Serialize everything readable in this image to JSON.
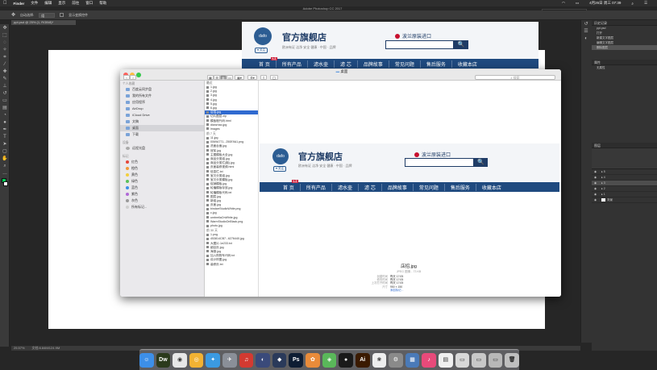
{
  "menubar": {
    "apple": "",
    "items": [
      "Finder",
      "文件",
      "编辑",
      "显示",
      "前往",
      "窗口",
      "帮助"
    ],
    "right_time": "4月26日 周三 07:39"
  },
  "ps_window_title": "Adobe Photoshop CC 2017",
  "tooltip": "预览此处就会变成切片",
  "options": {
    "mode_label": "自动选择:",
    "layer_select": "组",
    "transform_label": "显示变换控件"
  },
  "doc_tab": "ppt.psd @ 25% (1, RGB/8)*",
  "ps_status": {
    "zoom": "25.57%",
    "doc": "文档:6.84M/124.9M"
  },
  "history_panel": {
    "title": "历史记录",
    "items": [
      {
        "label": "ppt.psd",
        "selected": false
      },
      {
        "label": "打开",
        "selected": false
      },
      {
        "label": "新建文字图层",
        "selected": false
      },
      {
        "label": "编辑文字图层",
        "selected": false
      },
      {
        "label": "删除图层",
        "selected": true
      }
    ]
  },
  "props_panel": {
    "title": "属性",
    "sub": "无属性"
  },
  "layers_panel": {
    "title": "图层",
    "rows": [
      {
        "label": "5",
        "selected": false
      },
      {
        "label": "4",
        "selected": false
      },
      {
        "label": "3",
        "selected": true
      },
      {
        "label": "2",
        "selected": false
      },
      {
        "label": "1",
        "selected": false
      },
      {
        "label": "背景",
        "selected": false
      }
    ]
  },
  "web_header": {
    "logo_text": "dafo",
    "shop_name": "官方旗舰店",
    "shop_sub": "欧洲有证 洁净 安全 健康 · 中国 · 品牌",
    "follow": "♥ 关注",
    "origin": "波兰原装进口",
    "search_btn": "🔍",
    "badge": "热卖",
    "nav": [
      "首 页",
      "所有产品",
      "滤水壶",
      "滤 芯",
      "品牌故事",
      "常见问题",
      "售后服务",
      "收藏本店"
    ]
  },
  "finder": {
    "title": "桌面",
    "search_placeholder": "搜索",
    "sidebar": {
      "personal_header": "个人收藏",
      "personal": [
        {
          "label": "百度云同步盘",
          "selected": false
        },
        {
          "label": "我的所有文件",
          "selected": false
        },
        {
          "label": "应用程序",
          "selected": false
        },
        {
          "label": "AirDrop",
          "selected": false
        },
        {
          "label": "iCloud Drive",
          "selected": false
        },
        {
          "label": "文稿",
          "selected": false
        },
        {
          "label": "桌面",
          "selected": true
        },
        {
          "label": "下载",
          "selected": false
        }
      ],
      "devices_header": "设备",
      "devices": [
        "远程光盘"
      ],
      "tags_header": "标记",
      "tags": [
        {
          "label": "红色",
          "color": "#e5453a"
        },
        {
          "label": "橙色",
          "color": "#f19a38"
        },
        {
          "label": "黄色",
          "color": "#f3cf3d"
        },
        {
          "label": "绿色",
          "color": "#5ac05a"
        },
        {
          "label": "蓝色",
          "color": "#3d8fe8"
        },
        {
          "label": "紫色",
          "color": "#b16ad6"
        },
        {
          "label": "灰色",
          "color": "#9a9a9a"
        },
        {
          "label": "所有标记...",
          "color": "#cfcfcf"
        }
      ]
    },
    "list": {
      "header_recent": "最近",
      "recent": [
        {
          "label": "1.jpg",
          "selected": false
        },
        {
          "label": "2.jpg",
          "selected": false
        },
        {
          "label": "3.jpg",
          "selected": false
        },
        {
          "label": "4.jpg",
          "selected": false
        },
        {
          "label": "5.jpg",
          "selected": false
        },
        {
          "label": "6.jpg",
          "selected": false
        },
        {
          "label": "店招.jpg",
          "selected": true
        },
        {
          "label": "切片图层.zip",
          "selected": false
        },
        {
          "label": "模板程代码.html",
          "selected": false
        },
        {
          "label": "dianzhao.jpg",
          "selected": false
        },
        {
          "label": "images",
          "selected": false
        }
      ],
      "header_7days": "前 7 天",
      "days7": [
        "11.jpg",
        "0069A771...250E9A1.png",
        "洗面台面.jpg",
        "冠军.jpg",
        "主图模板大全.jpg",
        "商品分类组.jpg",
        "商品分类栏(副).jpg",
        "页面装修视频.html",
        "信息栏.txt",
        "宝贝分类组.jpg",
        "宝贝分类模板.jpg",
        "促销模板.jpg",
        "轮播模版存放.jpg",
        "轮播模板代码.txt",
        "图层.jpg",
        "新组.jpg",
        "页面.jpg",
        "bindarrStudioWhite.png",
        "c.jpg",
        "umbrellaOnWhite.jpg",
        "WarmStudioOnBlack.png",
        "photo.jpg"
      ],
      "header_30days": "前 30 天",
      "days30": [
        "1.png",
        "453814CB7...6276440.jpg",
        "大图片-1e233.txt",
        "细目页.jpg",
        "海报.jpg",
        "加入购物车代码.txt",
        "设计样图.jpg",
        "装修页.txt"
      ]
    },
    "preview": {
      "filename": "店招.jpg",
      "kind": "JPEG 图像 - 73 KB",
      "rows": [
        {
          "k": "创建时间",
          "v": "昨天 17:05"
        },
        {
          "k": "修改时间",
          "v": "昨天 17:05"
        },
        {
          "k": "上次打开时间",
          "v": "昨天 17:05"
        },
        {
          "k": "尺寸",
          "v": "950 × 150"
        }
      ],
      "add_tags": "添加标记..."
    }
  },
  "dock": [
    {
      "name": "finder",
      "label": "☺",
      "color": "#3d8fe8"
    },
    {
      "name": "dreamweaver",
      "label": "Dw",
      "color": "#2b3a1c"
    },
    {
      "name": "chrome",
      "label": "◉",
      "color": "#e8e8e8"
    },
    {
      "name": "baidu",
      "label": "◎",
      "color": "#f2b233"
    },
    {
      "name": "safari",
      "label": "✦",
      "color": "#3b9ae1"
    },
    {
      "name": "launchpad",
      "label": "✈",
      "color": "#8a8f98"
    },
    {
      "name": "netease",
      "label": "♫",
      "color": "#d33a31"
    },
    {
      "name": "cinema",
      "label": "◐",
      "color": "#3a4a7a"
    },
    {
      "name": "sketch",
      "label": "◆",
      "color": "#2a3a5a"
    },
    {
      "name": "photoshop",
      "label": "Ps",
      "color": "#0e1d33"
    },
    {
      "name": "color",
      "label": "✿",
      "color": "#e88b3a"
    },
    {
      "name": "maps",
      "label": "◈",
      "color": "#5ab85a"
    },
    {
      "name": "qq",
      "label": "●",
      "color": "#1a1a1a"
    },
    {
      "name": "illustrator",
      "label": "Ai",
      "color": "#3a1a00"
    },
    {
      "name": "photos",
      "label": "❀",
      "color": "#eeeeee"
    },
    {
      "name": "settings",
      "label": "⚙",
      "color": "#8a8a8a"
    },
    {
      "name": "preview",
      "label": "▦",
      "color": "#4a7ab8"
    },
    {
      "name": "music",
      "label": "♪",
      "color": "#e84a7a"
    },
    {
      "name": "calendar",
      "label": "▤",
      "color": "#f0f0f0"
    },
    {
      "name": "docs",
      "label": "▭",
      "color": "#d8d8d8"
    },
    {
      "name": "files",
      "label": "▭",
      "color": "#c8c8c8"
    },
    {
      "name": "files2",
      "label": "▭",
      "color": "#b8b8b8"
    },
    {
      "name": "trash",
      "label": "🗑",
      "color": "#bfbfbf"
    }
  ]
}
